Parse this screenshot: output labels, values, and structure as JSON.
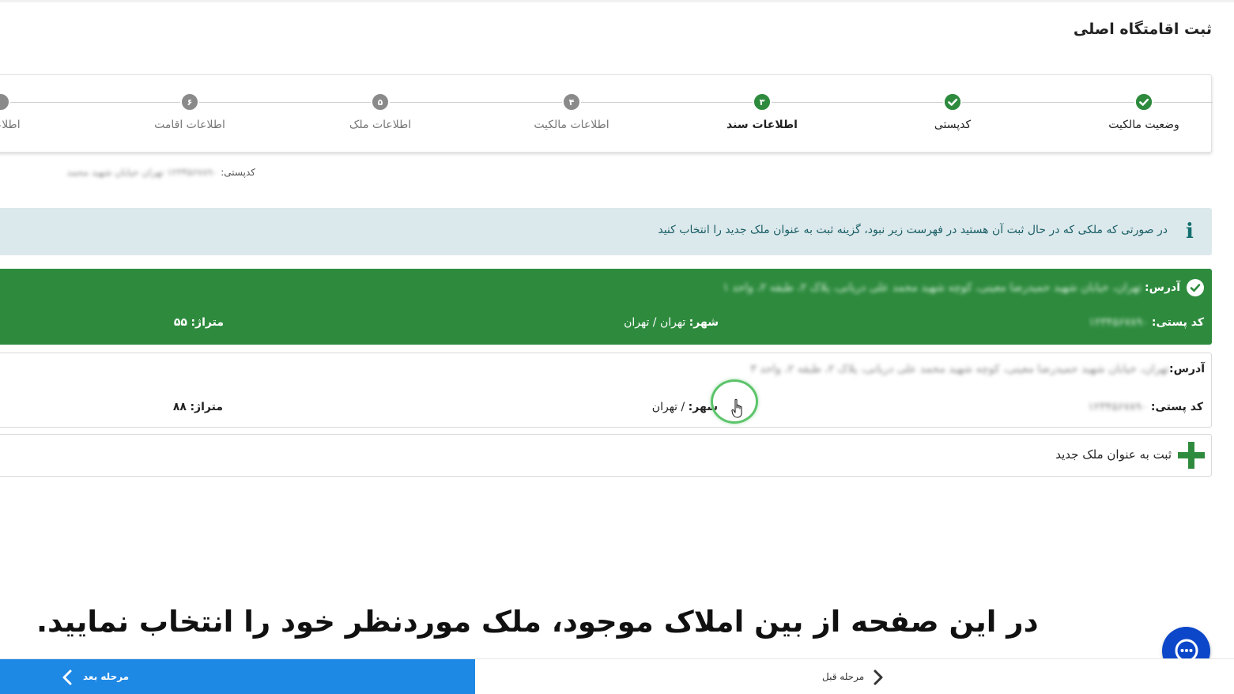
{
  "page": {
    "title": "ثبت اقامتگاه اصلی"
  },
  "stepper": {
    "steps": [
      {
        "label": "وضعیت مالکیت",
        "number": "",
        "state": "done"
      },
      {
        "label": "کدپستی",
        "number": "",
        "state": "done"
      },
      {
        "label": "اطلاعات سند",
        "number": "۳",
        "state": "active"
      },
      {
        "label": "اطلاعات مالکیت",
        "number": "۴",
        "state": "pending"
      },
      {
        "label": "اطلاعات ملک",
        "number": "۵",
        "state": "pending"
      },
      {
        "label": "اطلاعات اقامت",
        "number": "۶",
        "state": "pending"
      },
      {
        "label": "اطلاعات",
        "number": "",
        "state": "pending"
      }
    ]
  },
  "postal_code_line": {
    "label": "کدپستی:",
    "value_blurred": "۱۲۳۴۵۶۷۸۹۰ تهران خیابان شهید محمد"
  },
  "info": {
    "text": "در صورتی که ملکی که در حال ثبت آن هستید در فهرست زیر نبود، گزینه ثبت به عنوان ملک جدید را انتخاب کنید"
  },
  "properties": [
    {
      "selected": true,
      "address_label": "آدرس:",
      "address_blurred": "تهران، خیابان شهید حمیدرضا معینی، کوچه شهید محمد علی دریانی، پلاک ۲، طبقه ۲، واحد ۱",
      "postal_label": "کد پستی:",
      "postal_blurred": "۱۲۳۴۵۶۷۸۹۰",
      "city_label": "شهر:",
      "city_value": "تهران / تهران",
      "area_label": "متراژ:",
      "area_value": "۵۵"
    },
    {
      "selected": false,
      "address_label": "آدرس:",
      "address_blurred": "تهران، خیابان شهید حمیدرضا معینی، کوچه شهید محمد علی دریانی، پلاک ۲، طبقه ۲، واحد ۳",
      "postal_label": "کد پستی:",
      "postal_blurred": "۱۲۳۴۵۶۷۸۹۰",
      "city_label": "شهر:",
      "city_value": "/ تهران",
      "area_label": "متراژ:",
      "area_value": "۸۸"
    }
  ],
  "new_property": {
    "label": "ثبت به عنوان ملک جدید"
  },
  "caption": {
    "text": "در این صفحه از بین املاک موجود، ملک موردنظر خود را انتخاب نمایید."
  },
  "footer": {
    "next_label": "مرحله بعد",
    "prev_label": "مرحله قبل"
  },
  "colors": {
    "accent_green": "#2e8b3e",
    "next_blue": "#1e88e5",
    "chat_blue": "#0c47c9",
    "info_bg": "#dce9ec"
  },
  "icons": {
    "info": "info-icon",
    "check": "check-icon",
    "plus": "plus-icon",
    "chat": "chat-icon",
    "chevron_left": "chevron-left-icon",
    "chevron_right": "chevron-right-icon",
    "hand_cursor": "hand-cursor-icon"
  }
}
